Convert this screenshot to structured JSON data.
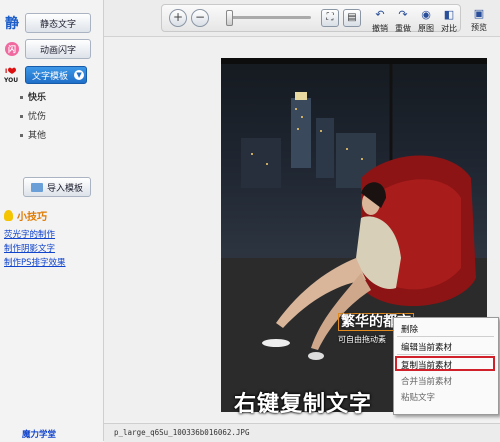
{
  "sidebar": {
    "static_text_button": "静态文字",
    "static_glyph": "静",
    "animated_text_button": "动画闪字",
    "text_template_button": "文字模板",
    "template_items": [
      "快乐",
      "忧伤",
      "其他"
    ],
    "import_template_button": "导入模板",
    "tips_title": "小技巧",
    "tip_links": [
      "荧光字的制作",
      "制作阴影文字",
      "制作PS排字效果"
    ],
    "footer": "魔力学堂"
  },
  "toolbar": {
    "tools": [
      {
        "icon": "undo-icon",
        "label": "撤销"
      },
      {
        "icon": "redo-icon",
        "label": "重做"
      },
      {
        "icon": "original-icon",
        "label": "原图"
      },
      {
        "icon": "compare-icon",
        "label": "对比"
      },
      {
        "icon": "preview-icon",
        "label": "预览"
      }
    ]
  },
  "canvas": {
    "caption_title": "繁华的都市",
    "caption_sub": "可自由拖动素",
    "overlay_instruction": "右键复制文字"
  },
  "context_menu": {
    "items": [
      "删除",
      "编辑当前素材",
      "复制当前素材",
      "合并当前素材",
      "粘贴文字"
    ],
    "highlighted_index": 2
  },
  "status": {
    "filename": "p_large_q6Su_100336b016062.JPG"
  },
  "colors": {
    "accent_blue": "#1f6fc9",
    "highlight_red": "#d0202a",
    "tip_orange": "#e07a00",
    "link_blue": "#1144cc"
  }
}
